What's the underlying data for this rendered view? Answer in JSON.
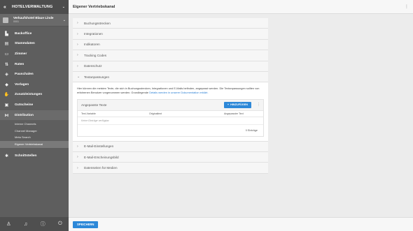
{
  "sidebar": {
    "app_title": "HOTELVERWALTUNG",
    "property": {
      "name": "Verkaufshotel Blaue Linde",
      "id": "0001"
    },
    "items": [
      {
        "label": "Backoffice",
        "icon": "building-icon"
      },
      {
        "label": "Stammdaten",
        "icon": "document-icon"
      },
      {
        "label": "Zimmer",
        "icon": "bed-icon"
      },
      {
        "label": "Raten",
        "icon": "rates-icon"
      },
      {
        "label": "Pauschalen",
        "icon": "tag-icon"
      },
      {
        "label": "Vorlagen",
        "icon": "layers-icon"
      },
      {
        "label": "Zusatzleistungen",
        "icon": "hand-icon"
      },
      {
        "label": "Gutscheine",
        "icon": "gift-icon"
      },
      {
        "label": "Distribution",
        "icon": "share-icon"
      }
    ],
    "distribution_sub": [
      "Interne Channels",
      "Channel Manager",
      "Meta Search",
      "Eigener Vertriebskanal"
    ],
    "schnittstellen": "Schnittstellen"
  },
  "topbar": {
    "title": "Eigener Vertriebskanal"
  },
  "sections_before": [
    "Buchungsstrecken",
    "Integrationen",
    "Indikatoren",
    "Tracking Codes",
    "Datenschutz"
  ],
  "open_section": {
    "title": "Textanpassungen",
    "description": "Hier können die meisten Texte, die sich in Buchungsstrecken, Integrationen und E-Mails befinden, angepasst werden. Die Textanpassungen sollten von erfahrenen Benutzer vorgenommen werden. Grundlegende",
    "link_text": "Details werden in unserer Dokumentation erklärt.",
    "card": {
      "title": "Angepasste Texte",
      "add_label": "HINZUFÜGEN",
      "columns": [
        "Text-Variable",
        "Originaltext",
        "Angepasster Text"
      ],
      "empty_text": "Keine Einträge verfügbar",
      "count_text": "0 Einträge"
    }
  },
  "sections_after": [
    "E-Mail-Einstellungen",
    "E-Mail-Erscheinungsbild",
    "Datenseiten für Medien"
  ],
  "footer": {
    "save_label": "SPEICHERN"
  }
}
